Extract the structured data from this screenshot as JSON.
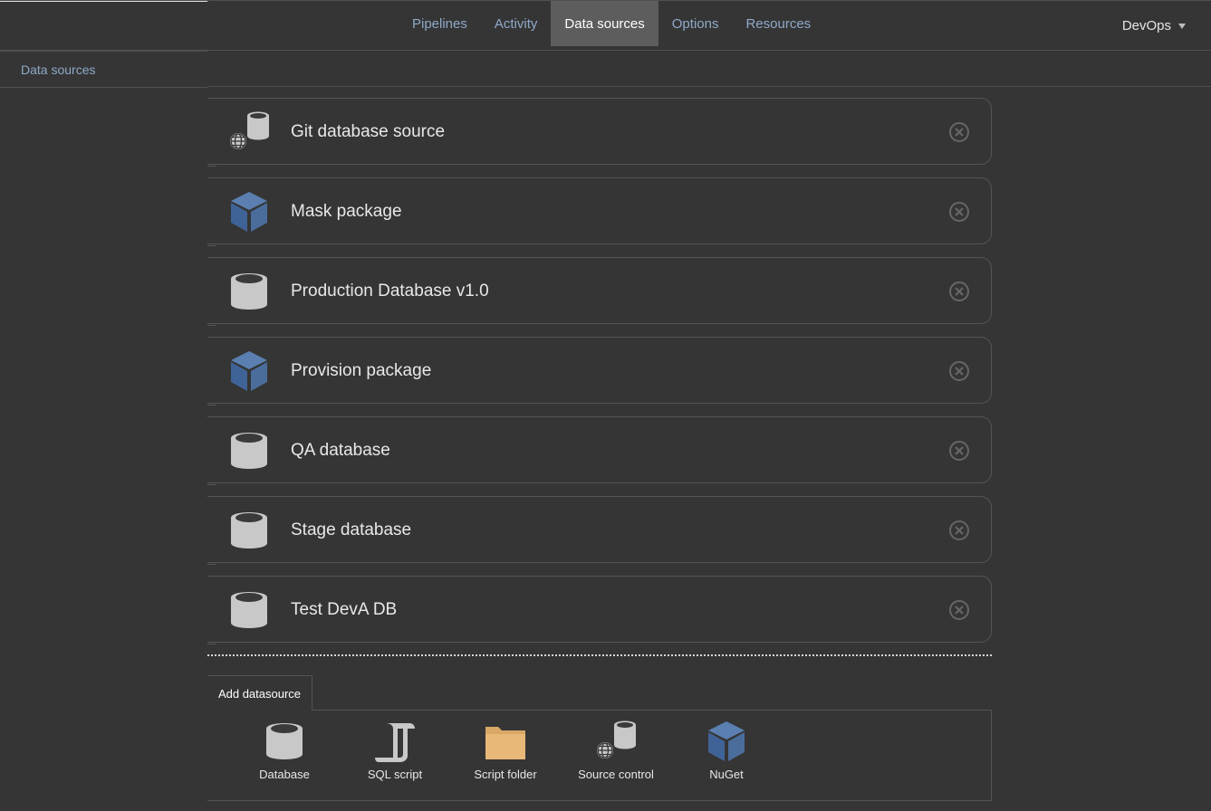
{
  "nav": {
    "items": [
      {
        "label": "Pipelines",
        "active": false
      },
      {
        "label": "Activity",
        "active": false
      },
      {
        "label": "Data sources",
        "active": true
      },
      {
        "label": "Options",
        "active": false
      },
      {
        "label": "Resources",
        "active": false
      }
    ],
    "user_menu": "DevOps"
  },
  "sidebar": {
    "tab_label": "Data sources"
  },
  "datasources": [
    {
      "name": "Git database source",
      "icon": "source-control-icon"
    },
    {
      "name": "Mask package",
      "icon": "nuget-package-icon"
    },
    {
      "name": "Production Database v1.0",
      "icon": "database-icon"
    },
    {
      "name": "Provision package",
      "icon": "nuget-package-icon"
    },
    {
      "name": "QA database",
      "icon": "database-icon"
    },
    {
      "name": "Stage database",
      "icon": "database-icon"
    },
    {
      "name": "Test DevA DB",
      "icon": "database-icon"
    }
  ],
  "add": {
    "tab_label": "Add datasource",
    "options": [
      {
        "label": "Database",
        "icon": "database-icon"
      },
      {
        "label": "SQL script",
        "icon": "script-icon"
      },
      {
        "label": "Script folder",
        "icon": "folder-icon"
      },
      {
        "label": "Source control",
        "icon": "source-control-icon"
      },
      {
        "label": "NuGet",
        "icon": "nuget-package-icon"
      }
    ]
  },
  "colors": {
    "background": "#353535",
    "link": "#8fa9c9",
    "nav_active_bg": "#5d5d5d",
    "package_blue": "#4a6d9c",
    "folder_tan": "#e8b878",
    "database_gray": "#c8c8c8"
  }
}
